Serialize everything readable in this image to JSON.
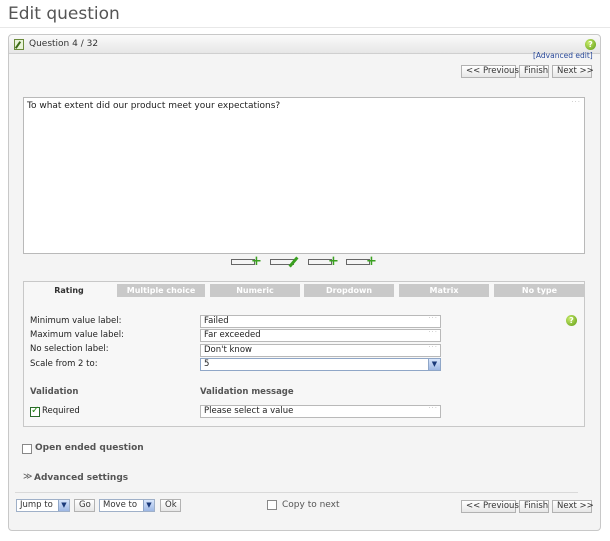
{
  "page": {
    "title": "Edit question"
  },
  "header": {
    "question_counter": "Question 4 / 32"
  },
  "nav": {
    "previous": "<< Previous",
    "finish": "Finish",
    "next": "Next >>"
  },
  "editor": {
    "advanced_edit": "[Advanced edit]",
    "question_text": "To what extent did our product meet your expectations?"
  },
  "tabs": [
    {
      "label": "Rating",
      "active": true
    },
    {
      "label": "Multiple choice"
    },
    {
      "label": "Numeric"
    },
    {
      "label": "Dropdown"
    },
    {
      "label": "Matrix"
    },
    {
      "label": "No type"
    }
  ],
  "rating": {
    "min_label": "Minimum value label:",
    "min_value": "Failed",
    "max_label": "Maximum value label:",
    "max_value": "Far exceeded",
    "nosel_label": "No selection label:",
    "nosel_value": "Don't know",
    "scale_label": "Scale from 2 to:",
    "scale_value": "5"
  },
  "validation": {
    "title": "Validation",
    "message_title": "Validation message",
    "required_label": "Required",
    "message_value": "Please select a value"
  },
  "options": {
    "open_ended": "Open ended question",
    "advanced_settings": "Advanced settings"
  },
  "footer": {
    "jump_to": "Jump to",
    "go": "Go",
    "move_to": "Move to",
    "ok": "Ok",
    "copy_to_next": "Copy to next"
  },
  "colors": {
    "accent": "#3aa020",
    "link": "#2a4a9a",
    "tab_inactive": "#c9c9c9"
  }
}
